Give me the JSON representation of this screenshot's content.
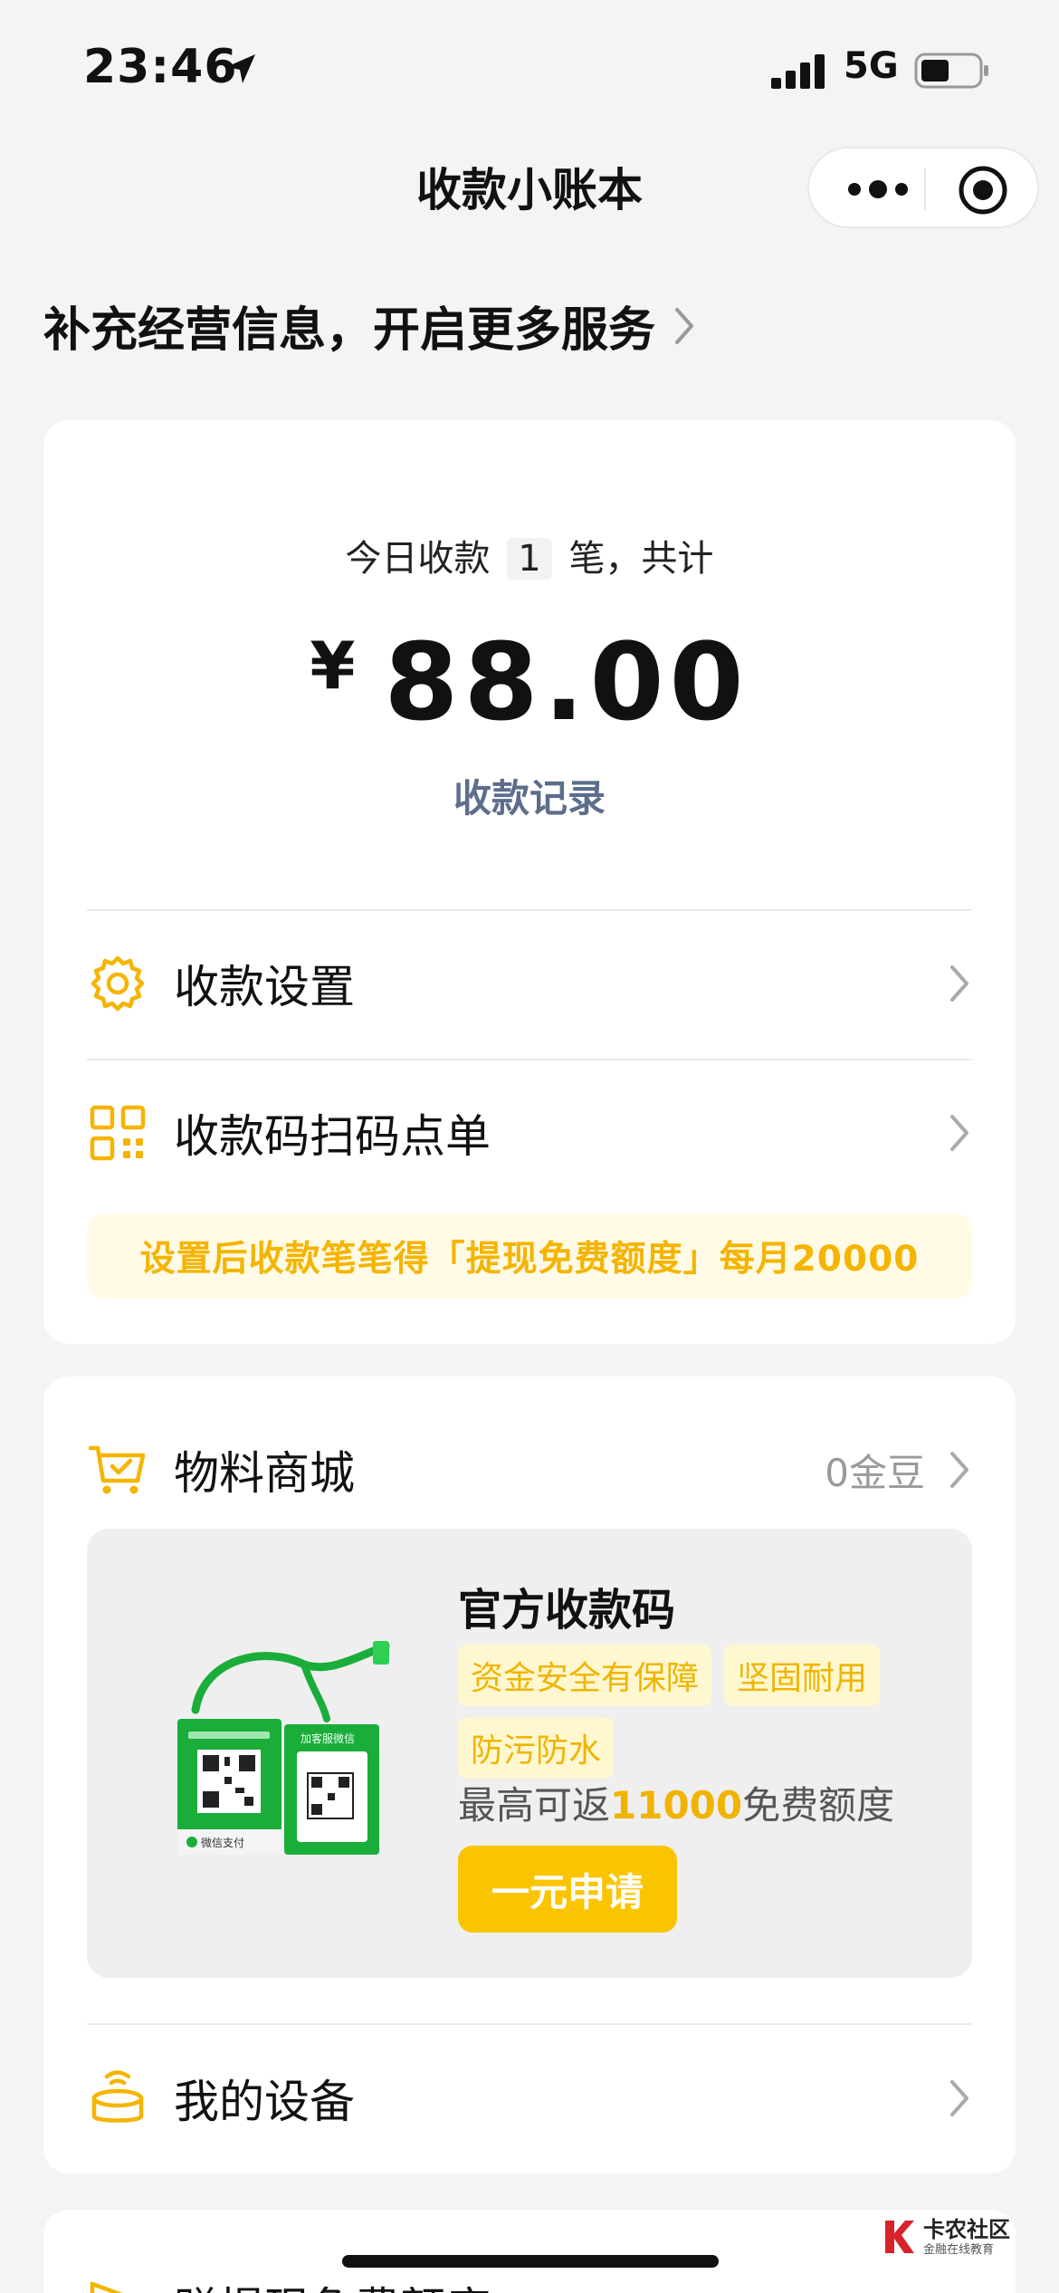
{
  "status_bar": {
    "time": "23:46",
    "network": "5G"
  },
  "nav": {
    "title": "收款小账本"
  },
  "promo": {
    "text": "补充经营信息，开启更多服务"
  },
  "summary": {
    "prefix": "今日收款",
    "count": "1",
    "suffix": "笔，共计",
    "currency": "¥",
    "amount": "88.00",
    "records_link": "收款记录"
  },
  "menu": {
    "settings": "收款设置",
    "qr_order": "收款码扫码点单",
    "tip": "设置后收款笔笔得「提现免费额度」每月20000"
  },
  "mall": {
    "title": "物料商城",
    "beans": "0金豆",
    "product_title": "官方收款码",
    "tags": [
      "资金安全有保障",
      "坚固耐用",
      "防污防水"
    ],
    "rebate_prefix": "最高可返",
    "rebate_value": "11000",
    "rebate_suffix": "免费额度",
    "apply_button": "一元申请",
    "product_card_texts": {
      "left_card": "微信支付",
      "right_card": "加客服微信"
    },
    "devices": "我的设备"
  },
  "next_card": {
    "label": "赚提现免费额度"
  },
  "watermark": {
    "main": "卡农社区",
    "sub": "金融在线教育"
  },
  "colors": {
    "accent_yellow": "#fbc400",
    "link_blue": "#5d6e8c",
    "wechat_green": "#1aad3a"
  }
}
